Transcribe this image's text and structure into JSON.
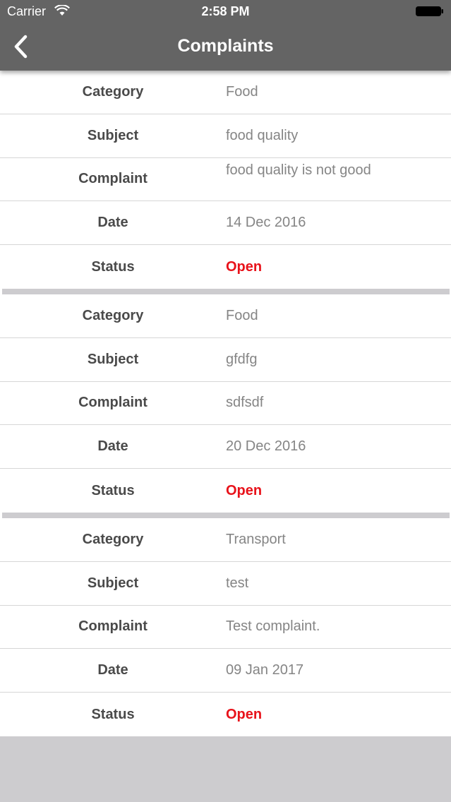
{
  "status_bar": {
    "carrier": "Carrier",
    "time": "2:58 PM",
    "wifi_icon": "wifi-icon",
    "battery_icon": "battery-icon"
  },
  "nav": {
    "title": "Complaints",
    "back_icon": "chevron-left-icon"
  },
  "colors": {
    "nav_background": "#646464",
    "status_open": "#e8121a",
    "page_background": "#cdcccf"
  },
  "complaints": [
    {
      "category_label": "Category",
      "category": "Food",
      "subject_label": "Subject",
      "subject": "food quality",
      "complaint_label": "Complaint",
      "complaint": "food quality is not good",
      "date_label": "Date",
      "date": "14 Dec 2016",
      "status_label": "Status",
      "status": "Open"
    },
    {
      "category_label": "Category",
      "category": "Food",
      "subject_label": "Subject",
      "subject": "gfdfg",
      "complaint_label": "Complaint",
      "complaint": "sdfsdf",
      "date_label": "Date",
      "date": "20 Dec 2016",
      "status_label": "Status",
      "status": "Open"
    },
    {
      "category_label": "Category",
      "category": "Transport",
      "subject_label": "Subject",
      "subject": "test",
      "complaint_label": "Complaint",
      "complaint": "Test complaint.",
      "date_label": "Date",
      "date": "09 Jan 2017",
      "status_label": "Status",
      "status": "Open"
    }
  ]
}
